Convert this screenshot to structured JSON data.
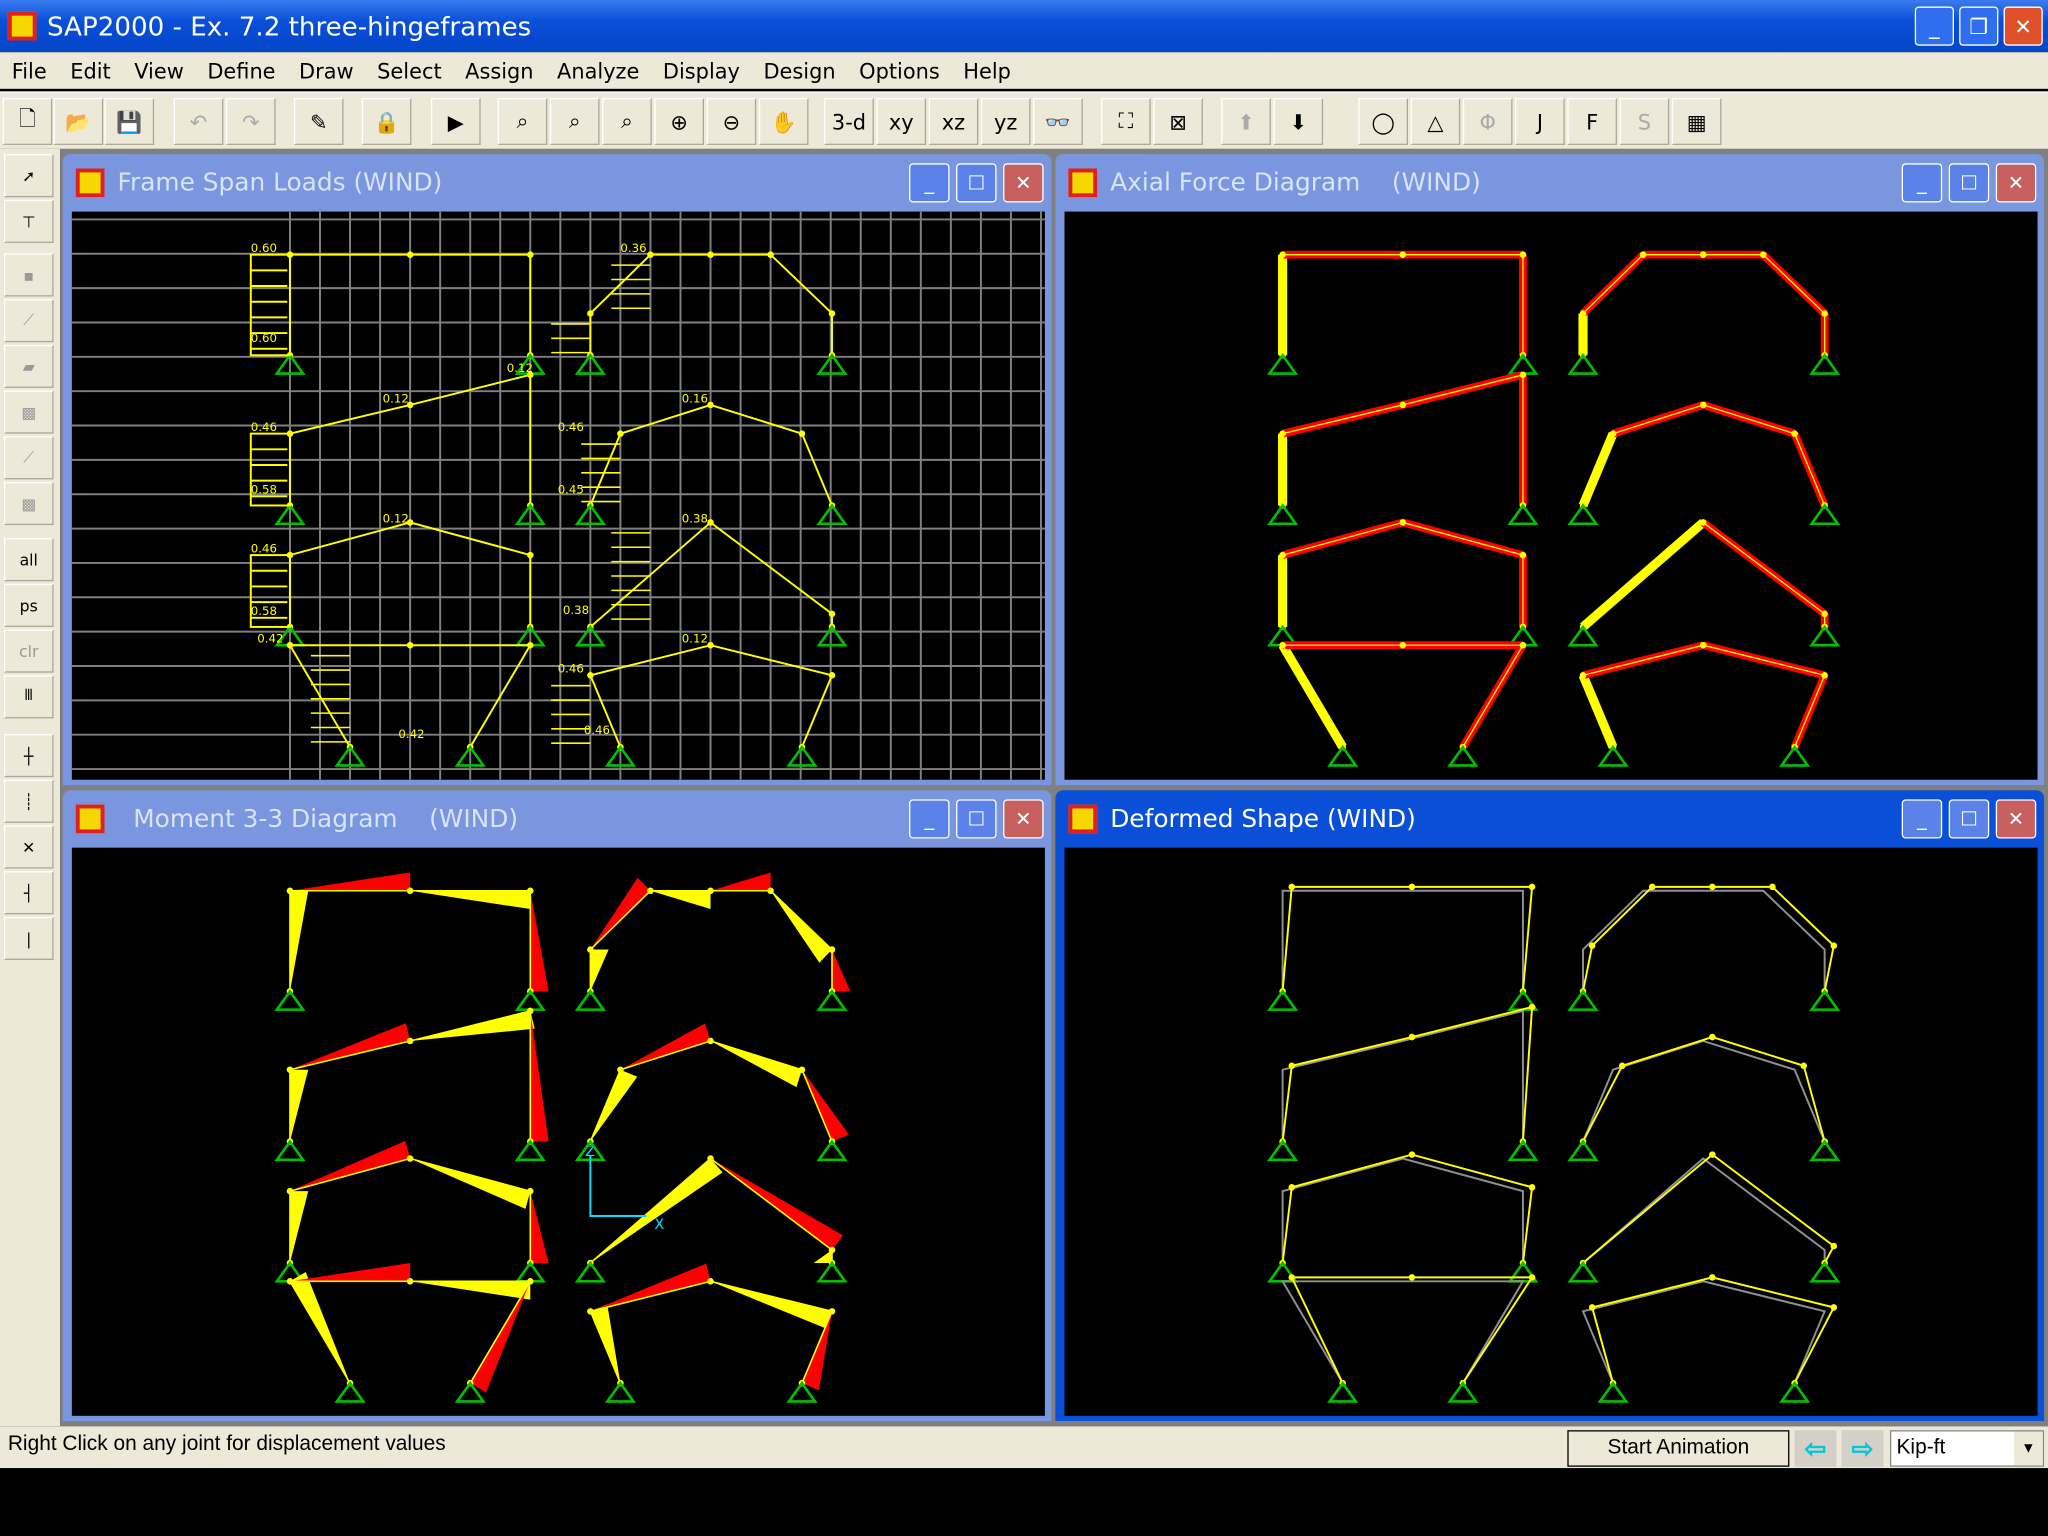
{
  "window": {
    "title": "SAP2000 - Ex. 7.2 three-hingeframes"
  },
  "menu": [
    "File",
    "Edit",
    "View",
    "Define",
    "Draw",
    "Select",
    "Assign",
    "Analyze",
    "Display",
    "Design",
    "Options",
    "Help"
  ],
  "toolbar": {
    "view_3d": "3-d",
    "view_xy": "xy",
    "view_xz": "xz",
    "view_yz": "yz",
    "joint_forces": "J",
    "frame_forces": "F",
    "shell_stresses": "S"
  },
  "left_toolbar": {
    "select_all": "all",
    "select_previous": "ps",
    "clear_selection": "clr"
  },
  "panels": {
    "span_loads": {
      "title": "Frame Span Loads (WIND)",
      "labels": [
        "0.60",
        "0.60",
        "0.36",
        "0.12",
        "0.12",
        "0.46",
        "0.58",
        "0.16",
        "0.46",
        "0.45",
        "0.12",
        "0.46",
        "0.58",
        "0.38",
        "0.38",
        "0.42",
        "0.42",
        "0.12",
        "0.46",
        "0.46"
      ]
    },
    "axial": {
      "title": "Axial Force Diagram    (WIND)"
    },
    "moment": {
      "title": "Moment 3-3 Diagram    (WIND)",
      "axis_z": "Z",
      "axis_x": "X"
    },
    "deformed": {
      "title": "Deformed Shape (WIND)"
    }
  },
  "colors": {
    "member": "#ffff00",
    "support": "#00c000",
    "negative": "#ff0000",
    "grid": "#808080"
  },
  "status": {
    "message": "Right Click on any joint for displacement values",
    "start_animation": "Start Animation",
    "units": "Kip-ft"
  }
}
